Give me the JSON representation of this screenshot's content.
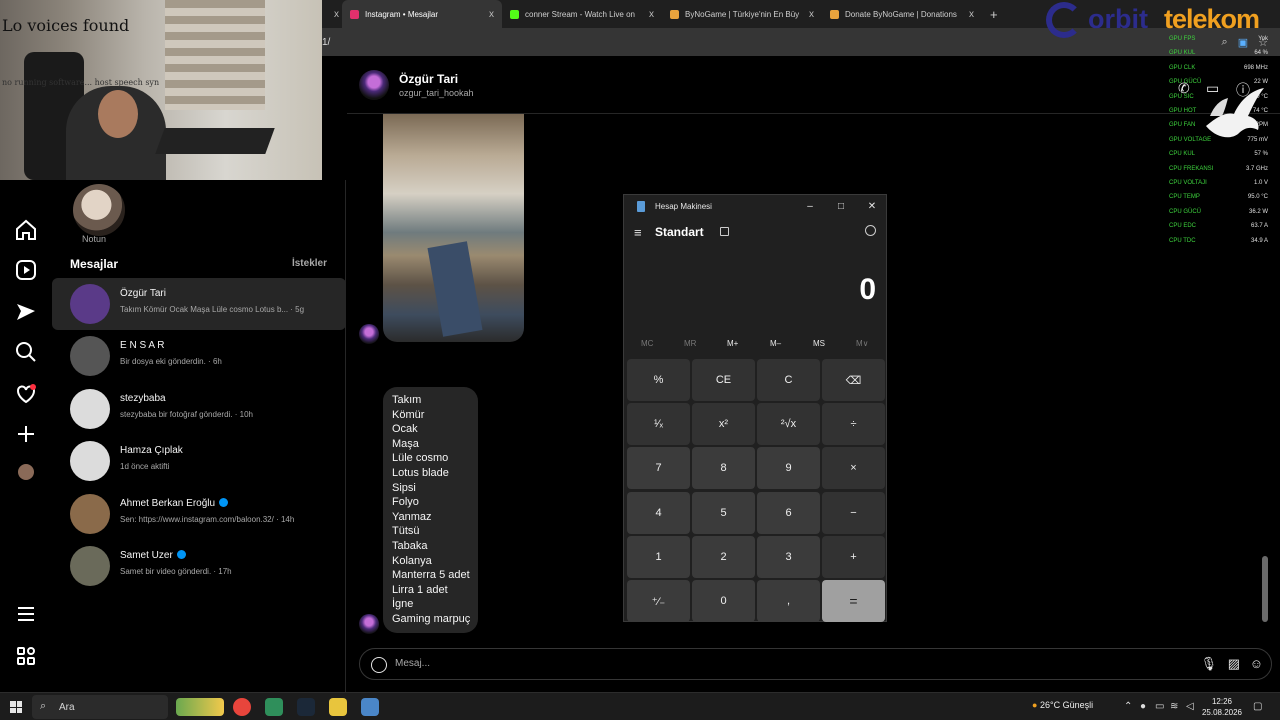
{
  "browser": {
    "tabs": [
      {
        "title": "Instagram • Mesajlar",
        "color": "#e1306c",
        "active": true
      },
      {
        "title": "conner Stream - Watch Live on",
        "color": "#53fc18",
        "active": false
      },
      {
        "title": "ByNoGame | Türkiye'nin En Büy",
        "color": "#e8a33d",
        "active": false
      },
      {
        "title": "Donate ByNoGame | Donations",
        "color": "#e8a33d",
        "active": false
      }
    ],
    "new_tab": "+",
    "close_glyph": "x",
    "address_fragment": "1/"
  },
  "webcam": {
    "title": "Lo voices found",
    "caption": "no running software... host speech syn"
  },
  "overlay": {
    "brand_prefix": "orbit",
    "brand_suffix": "telekom",
    "stats": [
      {
        "label": "GPU FPS",
        "value": "Yok"
      },
      {
        "label": "GPU KUL",
        "value": "64 %"
      },
      {
        "label": "GPU CLK",
        "value": "698 MHz"
      },
      {
        "label": "GPU GÜCÜ",
        "value": "22 W"
      },
      {
        "label": "GPU SIC",
        "value": "60 °C"
      },
      {
        "label": "GPU HOT",
        "value": "74 °C"
      },
      {
        "label": "GPU FAN",
        "value": "0 RPM"
      },
      {
        "label": "GPU VOLTAGE",
        "value": "775 mV"
      },
      {
        "label": "CPU KUL",
        "value": "57 %"
      },
      {
        "label": "CPU FREKANSI",
        "value": "3.7 GHz"
      },
      {
        "label": "CPU VOLTAJI",
        "value": "1.0 V"
      },
      {
        "label": "CPU TEMP",
        "value": "95.0 °C"
      },
      {
        "label": "CPU GÜCÜ",
        "value": "36.2 W"
      },
      {
        "label": "CPU EDC",
        "value": "63.7 A"
      },
      {
        "label": "CPU TDC",
        "value": "34.9 A"
      }
    ]
  },
  "sidebar": {
    "note_label": "Notun",
    "messages_title": "Mesajlar",
    "requests_label": "İstekler",
    "conversations": [
      {
        "name": "Özgür Tari",
        "preview": "Takım Kömür Ocak Maşa Lüle cosmo Lotus b... · 5g",
        "avatar": "#5a3a88",
        "verified": false,
        "selected": true
      },
      {
        "name": "E N S A R",
        "preview": "Bir dosya eki gönderdin. · 6h",
        "avatar": "#555555",
        "verified": false,
        "selected": false
      },
      {
        "name": "stezybaba",
        "preview": "stezybaba bir fotoğraf gönderdi. · 10h",
        "avatar": "#dcdcdc",
        "verified": false,
        "selected": false
      },
      {
        "name": "Hamza Çıplak",
        "preview": "1d önce aktifti",
        "avatar": "#dcdcdc",
        "verified": false,
        "selected": false
      },
      {
        "name": "Ahmet Berkan Eroğlu",
        "preview": "Sen: https://www.instagram.com/baloon.32/ · 14h",
        "avatar": "#8a6a4a",
        "verified": true,
        "selected": false
      },
      {
        "name": "Samet Uzer",
        "preview": "Samet bir video gönderdi. · 17h",
        "avatar": "#6a6a5a",
        "verified": true,
        "selected": false
      }
    ]
  },
  "chat": {
    "name": "Özgür Tari",
    "username": "ozgur_tari_hookah",
    "message_lines": [
      "Takım",
      "Kömür",
      "Ocak",
      "Maşa",
      "Lüle cosmo",
      "Lotus blade",
      "Sipsi",
      "Folyo",
      "Yanmaz",
      "Tütsü",
      "Tabaka",
      "Kolanya",
      "Manterra 5 adet",
      "Lirra 1 adet",
      "İgne",
      "Gaming marpuç"
    ],
    "composer_placeholder": "Mesaj..."
  },
  "calculator": {
    "app_title": "Hesap Makinesi",
    "mode": "Standart",
    "display": "0",
    "window_buttons": [
      "–",
      "□",
      "✕"
    ],
    "memory": [
      {
        "label": "MC",
        "enabled": false
      },
      {
        "label": "MR",
        "enabled": false
      },
      {
        "label": "M+",
        "enabled": true
      },
      {
        "label": "M–",
        "enabled": true
      },
      {
        "label": "MS",
        "enabled": true
      },
      {
        "label": "M∨",
        "enabled": false
      }
    ],
    "keys": [
      {
        "label": "%",
        "kind": "op"
      },
      {
        "label": "CE",
        "kind": "op"
      },
      {
        "label": "C",
        "kind": "op"
      },
      {
        "label": "⌫",
        "kind": "op"
      },
      {
        "label": "¹⁄ₓ",
        "kind": "op"
      },
      {
        "label": "x²",
        "kind": "op"
      },
      {
        "label": "²√x",
        "kind": "op"
      },
      {
        "label": "÷",
        "kind": "op"
      },
      {
        "label": "7",
        "kind": "num"
      },
      {
        "label": "8",
        "kind": "num"
      },
      {
        "label": "9",
        "kind": "num"
      },
      {
        "label": "×",
        "kind": "op"
      },
      {
        "label": "4",
        "kind": "num"
      },
      {
        "label": "5",
        "kind": "num"
      },
      {
        "label": "6",
        "kind": "num"
      },
      {
        "label": "−",
        "kind": "op"
      },
      {
        "label": "1",
        "kind": "num"
      },
      {
        "label": "2",
        "kind": "num"
      },
      {
        "label": "3",
        "kind": "num"
      },
      {
        "label": "+",
        "kind": "op"
      },
      {
        "label": "⁺⁄₋",
        "kind": "num"
      },
      {
        "label": "0",
        "kind": "num"
      },
      {
        "label": ",",
        "kind": "num"
      },
      {
        "label": "=",
        "kind": "eq"
      }
    ]
  },
  "taskbar": {
    "search_label": "Ara",
    "weather": "26°C  Güneşli",
    "time": "12:26",
    "date": "25.08.2026",
    "apps": [
      {
        "name": "chrome-icon",
        "color": "#e8453c"
      },
      {
        "name": "excel-icon",
        "color": "#2f8f5b"
      },
      {
        "name": "steam-icon",
        "color": "#1b2838"
      },
      {
        "name": "kick-icon",
        "color": "#e8c53d"
      },
      {
        "name": "calculator-icon",
        "color": "#4a86c8"
      }
    ]
  }
}
